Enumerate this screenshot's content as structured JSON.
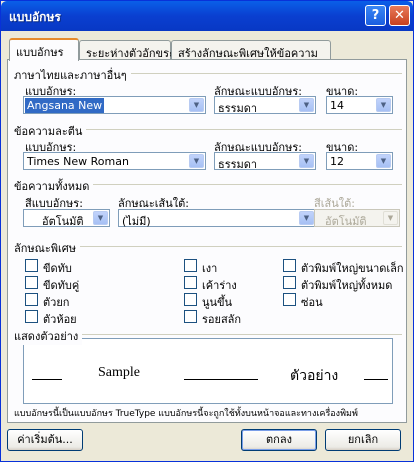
{
  "window": {
    "title": "แบบอักษร",
    "help_symbol": "?",
    "close_symbol": "✕"
  },
  "tabs": [
    {
      "label": "แบบอักษร"
    },
    {
      "label": "ระยะห่างตัวอักขระ"
    },
    {
      "label": "สร้างลักษณะพิเศษให้ข้อความ"
    }
  ],
  "thai_section": {
    "title": "ภาษาไทยและภาษาอื่นๆ",
    "font_label": "แบบอักษร:",
    "font_value": "Angsana New",
    "style_label": "ลักษณะแบบอักษร:",
    "style_value": "ธรรมดา",
    "size_label": "ขนาด:",
    "size_value": "14"
  },
  "latin_section": {
    "title": "ข้อความละตีน",
    "font_label": "แบบอักษร:",
    "font_value": "Times New Roman",
    "style_label": "ลักษณะแบบอักษร:",
    "style_value": "ธรรมดา",
    "size_label": "ขนาด:",
    "size_value": "12"
  },
  "all_text": {
    "title": "ข้อความทั้งหมด",
    "color_label": "สีแบบอักษร:",
    "color_value": "อัตโนมัติ",
    "underline_label": "ลักษณะเส้นใต้:",
    "underline_value": "(ไม่มี)",
    "underline_color_label": "สีเส้นใต้:",
    "underline_color_value": "อัตโนมัติ"
  },
  "effects": {
    "title": "ลักษณะพิเศษ",
    "items": [
      {
        "label": "ขีดทับ"
      },
      {
        "label": "ขีดทับคู่"
      },
      {
        "label": "ตัวยก"
      },
      {
        "label": "ตัวห้อย"
      },
      {
        "label": "เงา"
      },
      {
        "label": "เค้าร่าง"
      },
      {
        "label": "นูนขึ้น"
      },
      {
        "label": "รอยสลัก"
      },
      {
        "label": "ตัวพิมพ์ใหญ่ขนาดเล็ก"
      },
      {
        "label": "ตัวพิมพ์ใหญ่ทั้งหมด"
      },
      {
        "label": "ซ่อน"
      }
    ]
  },
  "preview": {
    "title": "แสดงตัวอย่าง",
    "latin_sample": "Sample",
    "thai_sample": "ตัวอย่าง"
  },
  "note": "แบบอักษรนี้เป็นแบบอักษร TrueType แบบอักษรนี้จะถูกใช้ทั้งบนหน้าจอและทางเครื่องพิมพ์",
  "buttons": {
    "default": "ค่าเริ่มต้น...",
    "ok": "ตกลง",
    "cancel": "ยกเลิก"
  }
}
